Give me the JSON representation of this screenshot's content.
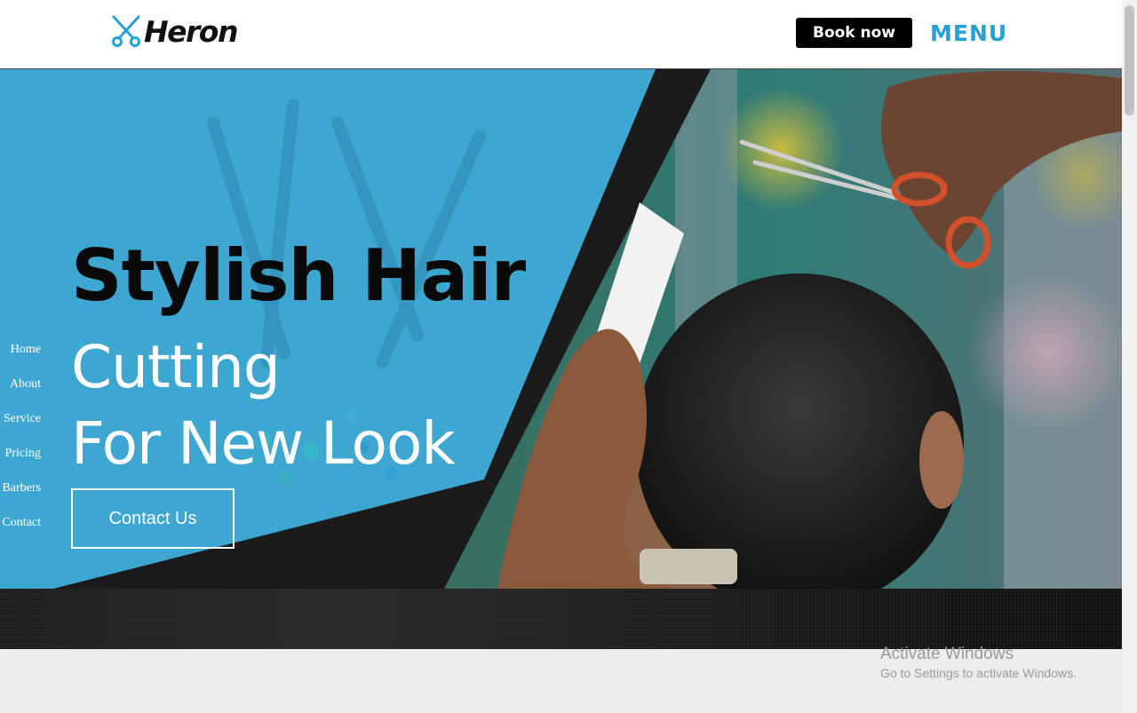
{
  "header": {
    "brand": "Heron",
    "book_label": "Book now",
    "menu_label": "MENU"
  },
  "hero": {
    "line1": "Stylish Hair",
    "line2": "Cutting",
    "line3": "For New Look",
    "cta_label": "Contact Us"
  },
  "side_nav": {
    "items": [
      {
        "label": "Home"
      },
      {
        "label": "About"
      },
      {
        "label": "Service"
      },
      {
        "label": "Pricing"
      },
      {
        "label": "Barbers"
      },
      {
        "label": "Contact"
      }
    ]
  },
  "watermark": {
    "title": "Activate Windows",
    "subtitle": "Go to Settings to activate Windows."
  },
  "colors": {
    "accent": "#25a0d8",
    "panel_blue": "#3eadd9",
    "dark": "#141414"
  }
}
